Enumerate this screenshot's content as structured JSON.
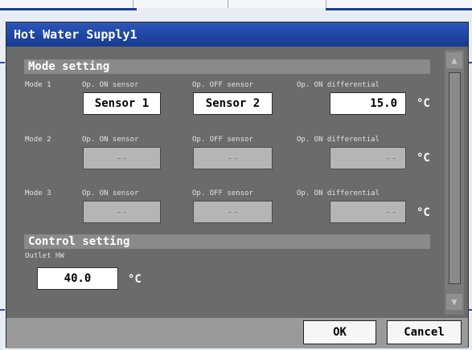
{
  "dialog": {
    "title": "Hot Water Supply1"
  },
  "mode_setting": {
    "header": "Mode setting",
    "col_on_sensor": "Op. ON sensor",
    "col_off_sensor": "Op. OFF sensor",
    "col_on_diff": "Op. ON differential",
    "unit": "°C",
    "modes": [
      {
        "label": "Mode 1",
        "on_sensor": "Sensor 1",
        "off_sensor": "Sensor 2",
        "differential": "15.0"
      },
      {
        "label": "Mode 2",
        "on_sensor": "--",
        "off_sensor": "--",
        "differential": "--"
      },
      {
        "label": "Mode 3",
        "on_sensor": "--",
        "off_sensor": "--",
        "differential": "--"
      }
    ]
  },
  "control_setting": {
    "header": "Control setting",
    "outlet_label": "Outlet HW",
    "outlet_value": "40.0",
    "unit": "°C"
  },
  "scrollbar": {
    "up_icon": "triangle-up",
    "down_icon": "triangle-down"
  },
  "buttons": {
    "ok": "OK",
    "cancel": "Cancel"
  }
}
